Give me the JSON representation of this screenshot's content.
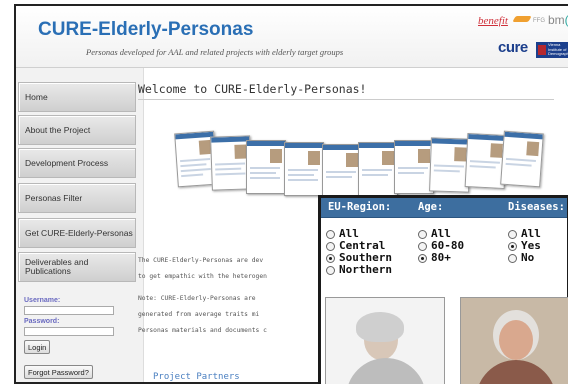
{
  "header": {
    "title": "CURE-Elderly-Personas",
    "subtitle": "Personas developed for AAL and related projects with elderly target groups",
    "logos": {
      "benefit": "benefit",
      "ffg": "FFG",
      "bm_prefix": "bm",
      "bm_suffix": "(",
      "cure": "cure",
      "vi": "Vienna Institute of Demography"
    }
  },
  "sidebar": {
    "nav": [
      {
        "label": "Home"
      },
      {
        "label": "About the Project"
      },
      {
        "label": "Development Process"
      },
      {
        "label": "Personas Filter"
      },
      {
        "label": "Get CURE-Elderly-Personas"
      },
      {
        "label": "Deliverables and Publications"
      }
    ],
    "username_label": "Username:",
    "password_label": "Password:",
    "login_label": "Login",
    "forgot_label": "Forgot Password?"
  },
  "main": {
    "heading": "Welcome to CURE-Elderly-Personas!",
    "para1_line1": "The CURE-Elderly-Personas are dev",
    "para1_line2": "to get empathic with the heterogen",
    "note_line1": "Note: CURE-Elderly-Personas are",
    "note_line2": "generated from average traits mi",
    "note_line3": "Personas materials and documents c",
    "partners_heading": "Project Partners"
  },
  "filter": {
    "colors": {
      "header_bg": "#3d6e9f",
      "header_text": "#ffffff"
    },
    "columns": [
      {
        "title": "EU-Region:",
        "options": [
          {
            "label": "All",
            "selected": false
          },
          {
            "label": "Central",
            "selected": false
          },
          {
            "label": "Southern",
            "selected": true
          },
          {
            "label": "Northern",
            "selected": false
          }
        ]
      },
      {
        "title": "Age:",
        "options": [
          {
            "label": "All",
            "selected": false
          },
          {
            "label": "60-80",
            "selected": false
          },
          {
            "label": "80+",
            "selected": true
          }
        ]
      },
      {
        "title": "Diseases:",
        "options": [
          {
            "label": "All",
            "selected": false
          },
          {
            "label": "Yes",
            "selected": true
          },
          {
            "label": "No",
            "selected": false
          }
        ]
      }
    ]
  }
}
